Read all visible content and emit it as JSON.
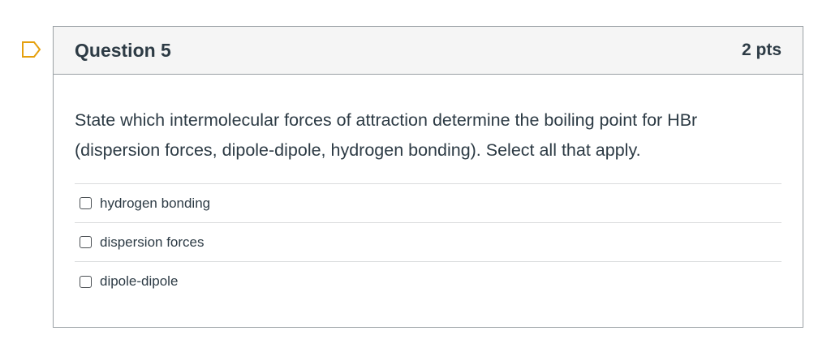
{
  "question": {
    "title": "Question 5",
    "points": "2 pts",
    "text": "State which intermolecular forces of attraction determine the boiling point for HBr (dispersion forces, dipole-dipole, hydrogen bonding).  Select all that apply.",
    "flag_icon": "bookmark-flag-icon",
    "answers": [
      {
        "label": "hydrogen bonding",
        "checked": false
      },
      {
        "label": "dispersion forces",
        "checked": false
      },
      {
        "label": "dipole-dipole",
        "checked": false
      }
    ]
  }
}
